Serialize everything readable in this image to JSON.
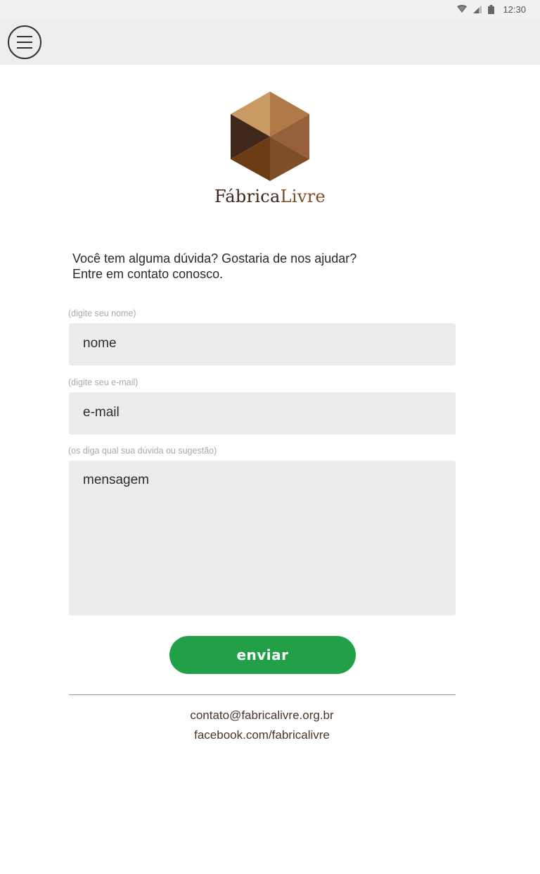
{
  "status_bar": {
    "time": "12:30",
    "icons": [
      "wifi-icon",
      "signal-icon",
      "battery-icon"
    ]
  },
  "app_bar": {
    "menu_icon": "hamburger-menu-icon"
  },
  "brand": {
    "name_part1": "Fábrica",
    "name_part2": "Livre",
    "colors": {
      "dark": "#3d2618",
      "accent": "#7d4e26"
    }
  },
  "intro": {
    "line1": "Você tem alguma dúvida? Gostaria de nos ajudar?",
    "line2": "Entre em contato conosco."
  },
  "form": {
    "name": {
      "hint": "(digite seu nome)",
      "placeholder": "nome"
    },
    "email": {
      "hint": "(digite seu e-mail)",
      "placeholder": "e-mail"
    },
    "message": {
      "hint": "(os diga qual sua dúvida ou sugestão)",
      "placeholder": "mensagem"
    },
    "submit_label": "enviar",
    "submit_color": "#21a047"
  },
  "footer": {
    "email": "contato@fabricalivre.org.br",
    "facebook": "facebook.com/fabricalivre"
  }
}
